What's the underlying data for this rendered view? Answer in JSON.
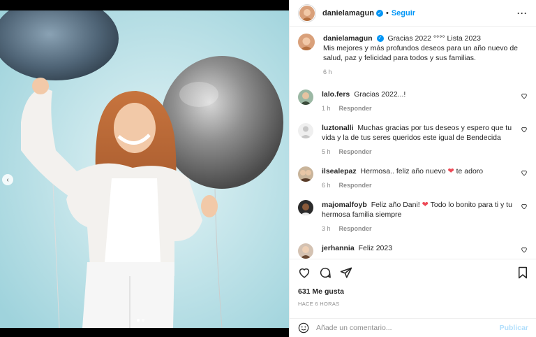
{
  "post": {
    "username": "danielamagun",
    "follow_label": "Seguir",
    "separator": "•",
    "more_label": "···",
    "caption_title": "Gracias 2022 °°°° Lista 2023",
    "caption_body": "Mis mejores y más profundos deseos para un año nuevo de salud, paz y felicidad para todos y sus familias.",
    "caption_time": "6 h",
    "likes": "631 Me gusta",
    "posted_when": "HACE 6 HORAS",
    "nav_prev_label": "‹"
  },
  "comments": [
    {
      "user": "lalo.fers",
      "pre": "Gracias 2022...!",
      "post": "",
      "heart": false,
      "time": "1 h",
      "reply": "Responder"
    },
    {
      "user": "luztonalli",
      "pre": "Muchas gracias por tus deseos y espero que tu vida y la de tus seres queridos este igual de Bendecida",
      "post": "",
      "heart": false,
      "time": "5 h",
      "reply": "Responder"
    },
    {
      "user": "ilsealepaz",
      "pre": "Hermosa.. feliz año nuevo",
      "post": "te adoro",
      "heart": true,
      "time": "6 h",
      "reply": "Responder"
    },
    {
      "user": "majomalfoyb",
      "pre": "Feliz año Dani!",
      "post": "Todo lo bonito para ti y tu hermosa familia siempre",
      "heart": true,
      "time": "3 h",
      "reply": "Responder"
    },
    {
      "user": "jerhannia",
      "pre": "Feliz 2023",
      "post": "",
      "heart": false,
      "time": "",
      "reply": ""
    }
  ],
  "comment_bar": {
    "placeholder": "Añade un comentario...",
    "publish_label": "Publicar"
  },
  "icons": [
    "heart-icon",
    "comment-icon",
    "share-icon",
    "bookmark-icon",
    "emoji-icon",
    "verified-icon",
    "more-icon"
  ],
  "colors": {
    "accent": "#0095f6",
    "heart": "#ed4956",
    "background": "#a9d8e0"
  }
}
